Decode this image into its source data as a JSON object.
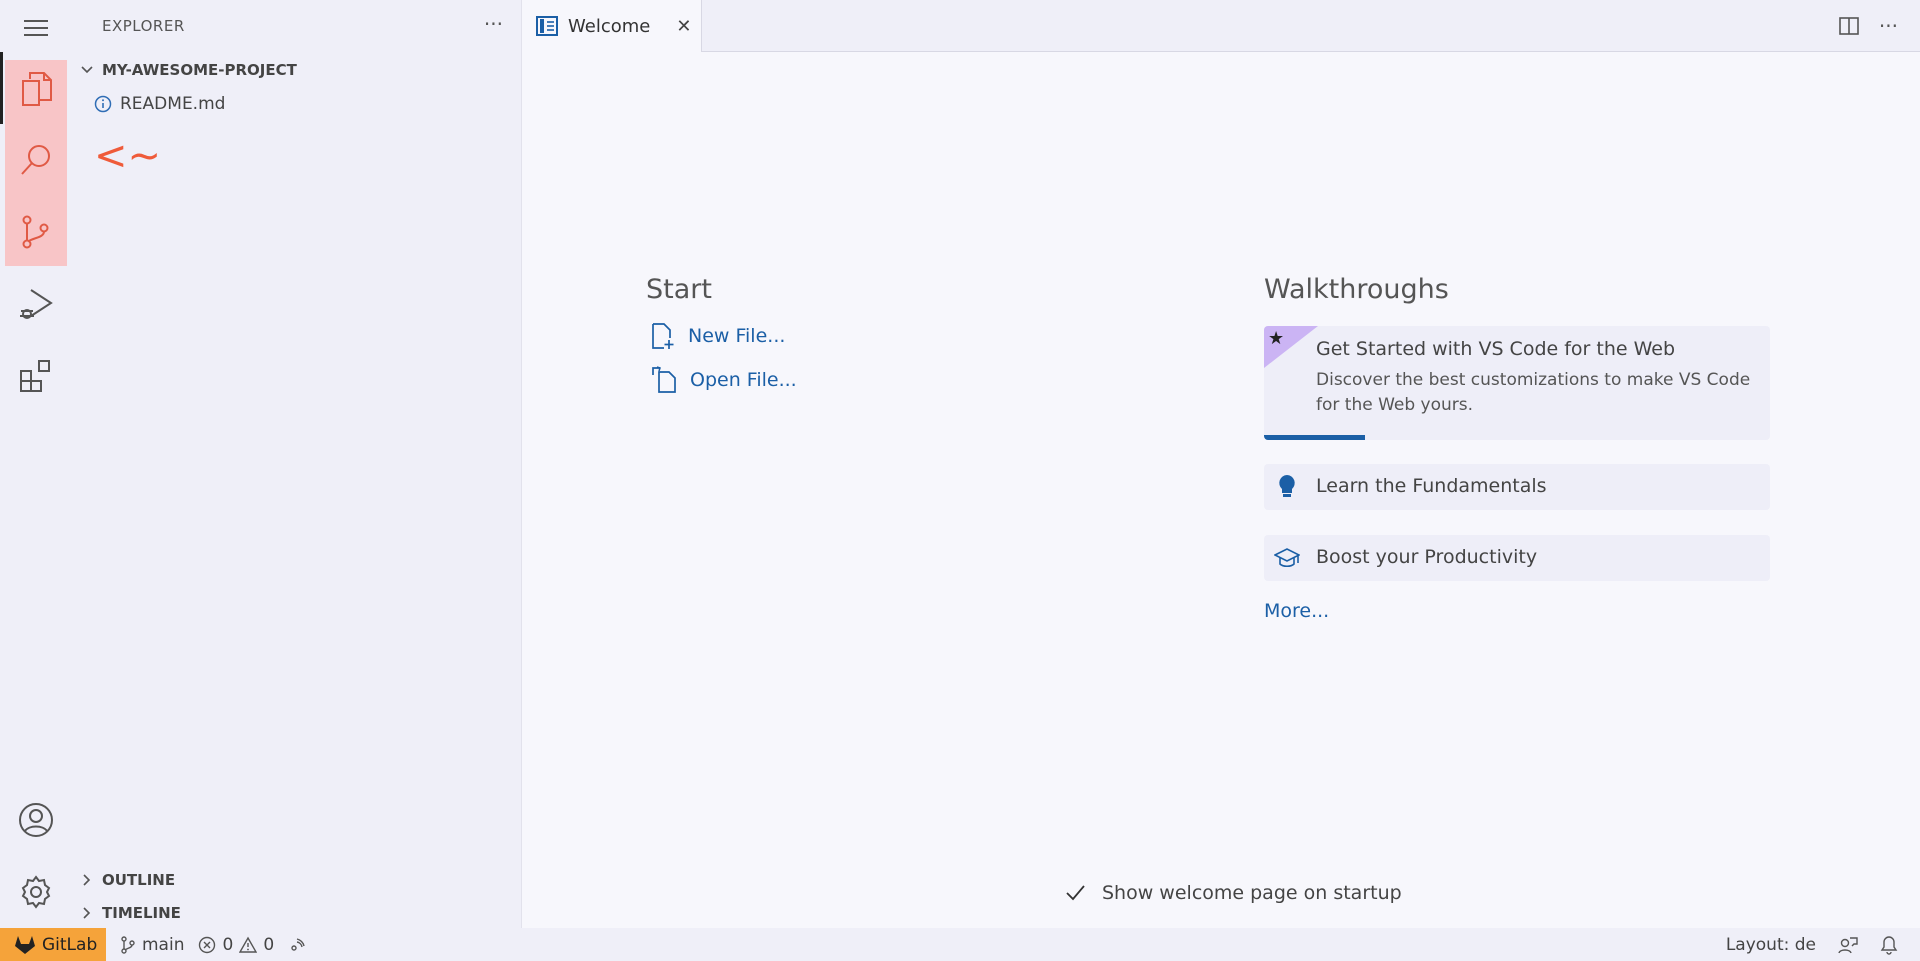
{
  "sidebar": {
    "title": "EXPLORER",
    "project_name": "MY-AWESOME-PROJECT",
    "files": [
      "README.md"
    ],
    "annotation": "<~",
    "outline_label": "OUTLINE",
    "timeline_label": "TIMELINE"
  },
  "tab": {
    "label": "Welcome",
    "close": "✕"
  },
  "start": {
    "heading": "Start",
    "new_file": "New File...",
    "open_file": "Open File..."
  },
  "walkthroughs": {
    "heading": "Walkthroughs",
    "featured_title": "Get Started with VS Code for the Web",
    "featured_desc": "Discover the best customizations to make VS Code for the Web yours.",
    "featured_progress": 0.2,
    "fundamentals": "Learn the Fundamentals",
    "productivity": "Boost your Productivity",
    "more": "More..."
  },
  "startup_checkbox_label": "Show welcome page on startup",
  "statusbar": {
    "gitlab": "GitLab",
    "branch": "main",
    "errors": "0",
    "warnings": "0",
    "layout": "Layout: de"
  },
  "colors": {
    "accent": "#1b5fa6",
    "highlight": "#f8c5c7",
    "annotation": "#ef5b3a",
    "gitlab": "#f5a33a"
  }
}
